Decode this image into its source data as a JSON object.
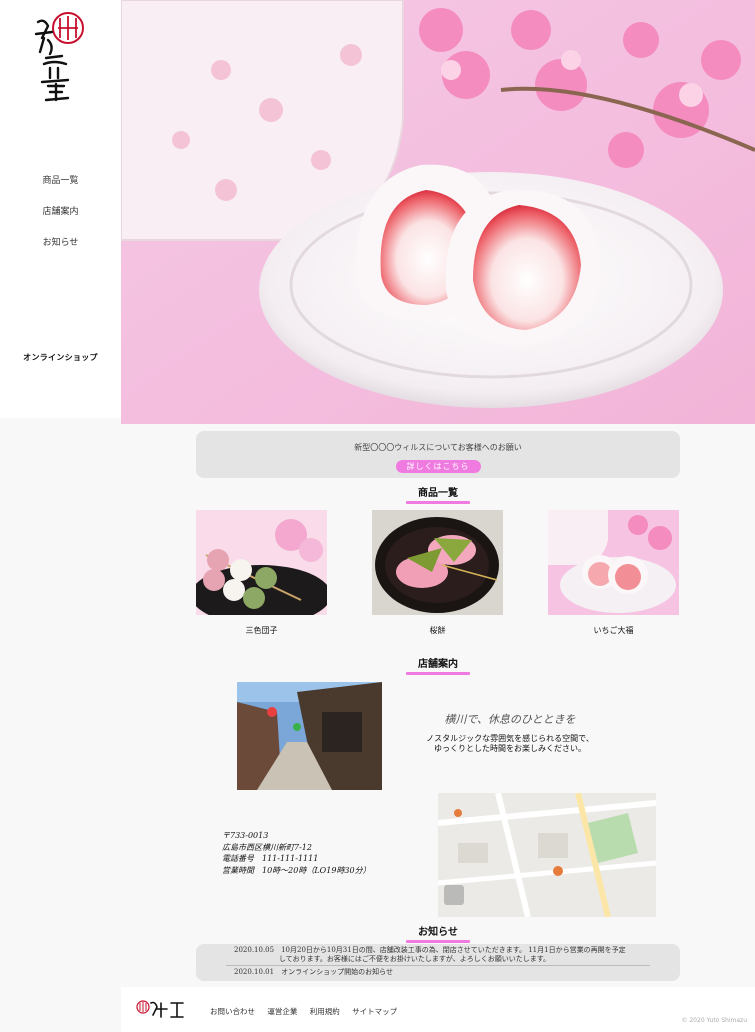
{
  "sidebar": {
    "logo_text": "猫空堂",
    "nav": [
      "商品一覧",
      "店舗案内",
      "お知らせ"
    ],
    "shop_link": "オンラインショップ"
  },
  "notice": {
    "text": "新型〇〇〇ウィルスについてお客様へのお願い",
    "button": "詳しくはこちら"
  },
  "products": {
    "title": "商品一覧",
    "items": [
      "三色団子",
      "桜餅",
      "いちご大福"
    ]
  },
  "store": {
    "title": "店舗案内",
    "catch_title": "横川で、休息のひとときを",
    "catch_line1": "ノスタルジックな雰囲気を感じられる空間で、",
    "catch_line2": "ゆっくりとした時間をお楽しみください。",
    "address": [
      "〒733-0013",
      "広島市西区横川新町7-12",
      "電話番号　111-111-1111",
      "営業時間　10時〜20時（LO19時30分）"
    ]
  },
  "news": {
    "title": "お知らせ",
    "items": [
      {
        "line1": "2020.10.05　10月20日から10月31日の間、店舗改装工事の為、閉店させていただきます。 11月1日から営業の再開を予定",
        "line2": "しております。お客様にはご不便をお掛けいたしますが、よろしくお願いいたします。"
      },
      {
        "line1": "2020.10.01　オンラインショップ開始のお知らせ"
      }
    ]
  },
  "footer": {
    "links": [
      "お問い合わせ",
      "運営企業",
      "利用規約",
      "サイトマップ"
    ],
    "copyright": "© 2020 Yuto Shimazu"
  },
  "colors": {
    "accent": "#f07be0",
    "background": "#f8f8f8"
  }
}
